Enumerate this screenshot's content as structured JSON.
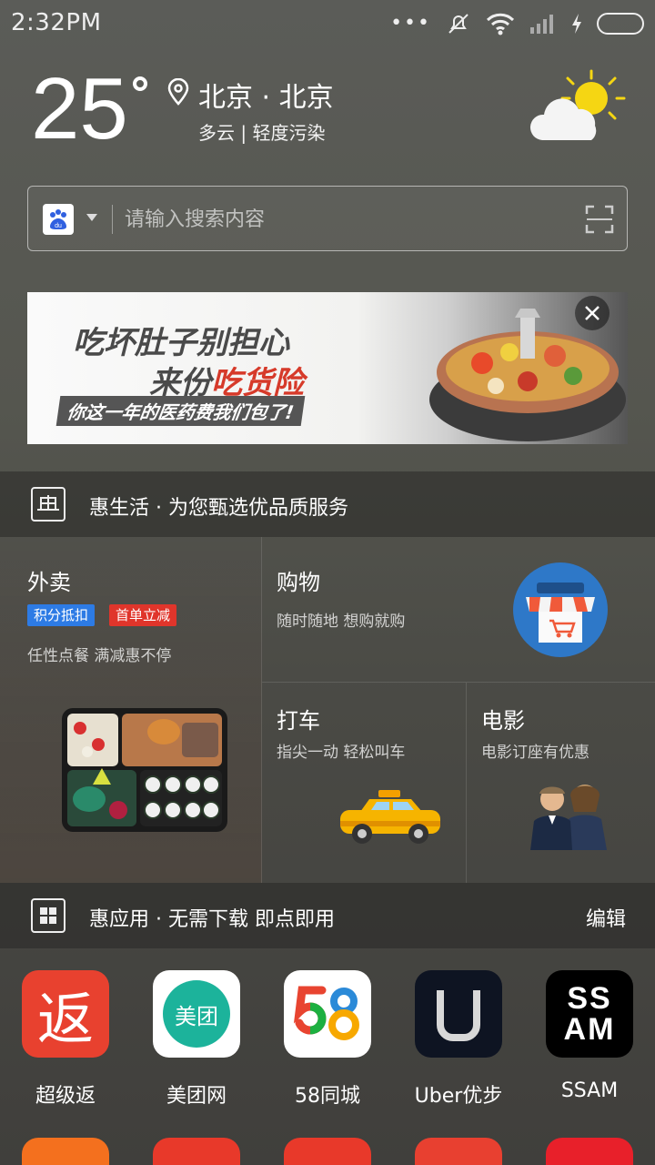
{
  "status": {
    "time": "2:32PM"
  },
  "weather": {
    "temperature": "25",
    "city": "北京 · 北京",
    "condition": "多云  |  轻度污染"
  },
  "search": {
    "placeholder": "请输入搜索内容",
    "engine_icon": "baidu-icon"
  },
  "banner": {
    "line1": "吃坏肚子别担心",
    "line2_prefix": "来份",
    "line2_highlight": "吃货险",
    "line3": "你这一年的医药费我们包了!"
  },
  "section_life": {
    "title": "惠生活 · 为您甄选优品质服务"
  },
  "services": {
    "waimai": {
      "title": "外卖",
      "tag1": "积分抵扣",
      "tag2": "首单立减",
      "sub": "任性点餐 满减惠不停"
    },
    "gouwu": {
      "title": "购物",
      "sub": "随时随地 想购就购"
    },
    "dache": {
      "title": "打车",
      "sub": "指尖一动 轻松叫车"
    },
    "dianying": {
      "title": "电影",
      "sub": "电影订座有优惠"
    }
  },
  "section_apps": {
    "title": "惠应用 · 无需下载 即点即用",
    "edit": "编辑"
  },
  "apps": [
    {
      "label": "超级返",
      "icon_text": "返",
      "color": "#e8412f"
    },
    {
      "label": "美团网",
      "icon_text": "美团",
      "color": "#1cb39b"
    },
    {
      "label": "58同城",
      "icon_text": "58",
      "color": "#ffffff"
    },
    {
      "label": "Uber优步",
      "icon_text": "U",
      "color": "#0e1422"
    },
    {
      "label": "SSAM",
      "icon_text": "SS\nAM",
      "color": "#000000"
    }
  ],
  "colors": {
    "tag_blue": "#2d7be5",
    "tag_red": "#e0352b"
  }
}
